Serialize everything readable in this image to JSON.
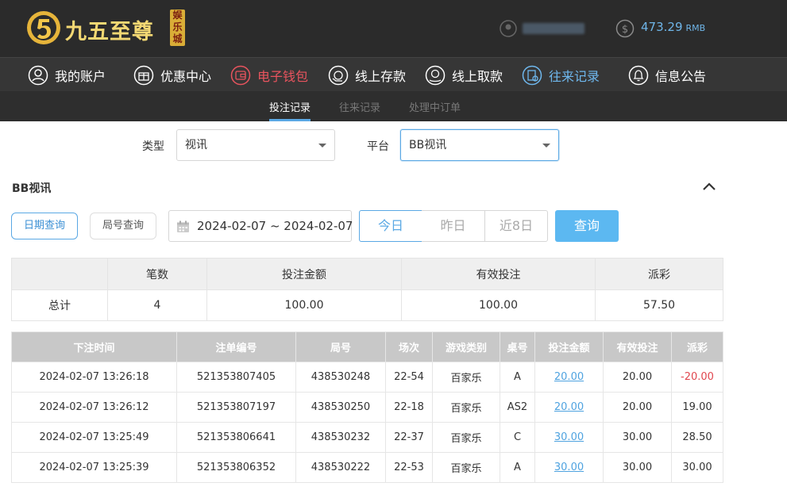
{
  "header": {
    "brand": "九五至尊",
    "brand_sub": "娱乐城",
    "balance": "473.29",
    "currency": "RMB"
  },
  "nav": [
    {
      "label": "我的账户",
      "icon": "user-icon"
    },
    {
      "label": "优惠中心",
      "icon": "gift-icon"
    },
    {
      "label": "电子钱包",
      "icon": "wallet-icon"
    },
    {
      "label": "线上存款",
      "icon": "deposit-icon"
    },
    {
      "label": "线上取款",
      "icon": "withdraw-icon"
    },
    {
      "label": "往来记录",
      "icon": "records-icon"
    },
    {
      "label": "信息公告",
      "icon": "bell-icon"
    }
  ],
  "subtabs": [
    "投注记录",
    "往来记录",
    "处理中订单"
  ],
  "filters": {
    "type_label": "类型",
    "type_value": "视讯",
    "platform_label": "平台",
    "platform_value": "BB视讯"
  },
  "section_title": "BB视讯",
  "query": {
    "date_query": "日期查询",
    "round_query": "局号查询",
    "date_range": "2024-02-07 ~ 2024-02-07",
    "today": "今日",
    "yesterday": "昨日",
    "last8": "近8日",
    "search": "查询"
  },
  "summary": {
    "headers": [
      "",
      "笔数",
      "投注金额",
      "有效投注",
      "派彩"
    ],
    "row": [
      "总计",
      "4",
      "100.00",
      "100.00",
      "57.50"
    ]
  },
  "detail": {
    "headers": [
      "下注时间",
      "注单编号",
      "局号",
      "场次",
      "游戏类别",
      "桌号",
      "投注金额",
      "有效投注",
      "派彩"
    ],
    "rows": [
      [
        "2024-02-07 13:26:18",
        "521353807405",
        "438530248",
        "22-54",
        "百家乐",
        "A",
        "20.00",
        "20.00",
        "-20.00"
      ],
      [
        "2024-02-07 13:26:12",
        "521353807197",
        "438530250",
        "22-18",
        "百家乐",
        "AS2",
        "20.00",
        "20.00",
        "19.00"
      ],
      [
        "2024-02-07 13:25:49",
        "521353806641",
        "438530232",
        "22-37",
        "百家乐",
        "C",
        "30.00",
        "30.00",
        "28.50"
      ],
      [
        "2024-02-07 13:25:39",
        "521353806352",
        "438530222",
        "22-53",
        "百家乐",
        "A",
        "30.00",
        "30.00",
        "30.00"
      ]
    ]
  },
  "colors": {
    "accent": "#5aa8e4",
    "negative": "#e0474f",
    "wallet": "#e9545e",
    "header_bg": "#2b2b2b"
  }
}
